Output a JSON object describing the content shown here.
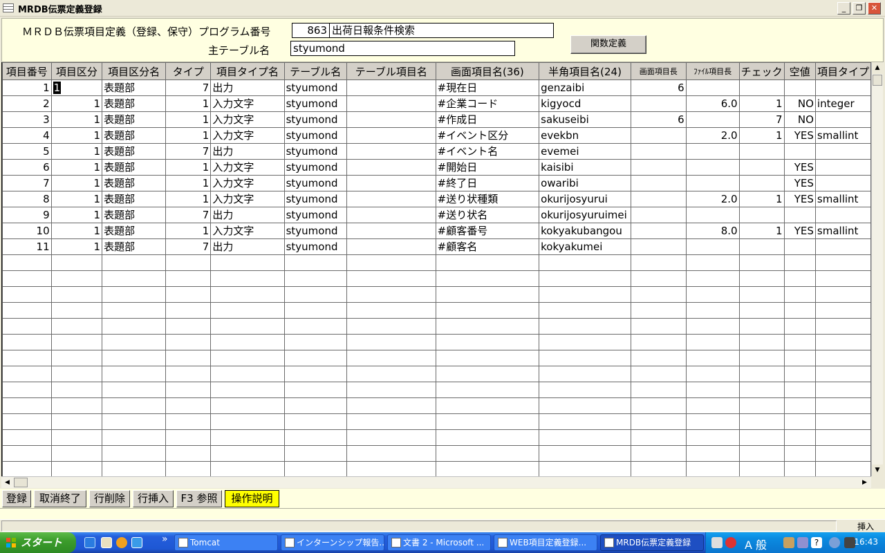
{
  "window": {
    "title": "MRDB伝票定義登録",
    "minimize_glyph": "_",
    "restore_glyph": "❐",
    "close_glyph": "✕"
  },
  "header": {
    "program_label": "ＭＲＤＢ伝票項目定義（登録、保守）プログラム番号",
    "program_number": "863",
    "program_name": "出荷日報条件検索",
    "main_table_label": "主テーブル名",
    "main_table_value": "styumond",
    "function_button": "関数定義"
  },
  "grid": {
    "columns": [
      "項目番号",
      "項目区分",
      "項目区分名",
      "タイプ",
      "項目タイプ名",
      "テーブル名",
      "テーブル項目名",
      "画面項目名(36)",
      "半角項目名(24)",
      "画面項目長",
      "ﾌｧｲﾙ項目長",
      "チェック",
      "空値",
      "項目タイプ"
    ],
    "rows": [
      [
        "1",
        "1",
        "表題部",
        "7",
        "出力",
        "styumond",
        "",
        "#現在日",
        "genzaibi",
        "6",
        "",
        "",
        "",
        ""
      ],
      [
        "2",
        "1",
        "表題部",
        "1",
        "入力文字",
        "styumond",
        "",
        "#企業コード",
        "kigyocd",
        "",
        "6.0",
        "1",
        "NO",
        "integer"
      ],
      [
        "3",
        "1",
        "表題部",
        "1",
        "入力文字",
        "styumond",
        "",
        "#作成日",
        "sakuseibi",
        "6",
        "",
        "7",
        "NO",
        ""
      ],
      [
        "4",
        "1",
        "表題部",
        "1",
        "入力文字",
        "styumond",
        "",
        "#イベント区分",
        "evekbn",
        "",
        "2.0",
        "1",
        "YES",
        "smallint"
      ],
      [
        "5",
        "1",
        "表題部",
        "7",
        "出力",
        "styumond",
        "",
        "#イベント名",
        "evemei",
        "",
        "",
        "",
        "",
        ""
      ],
      [
        "6",
        "1",
        "表題部",
        "1",
        "入力文字",
        "styumond",
        "",
        "#開始日",
        "kaisibi",
        "",
        "",
        "",
        "YES",
        ""
      ],
      [
        "7",
        "1",
        "表題部",
        "1",
        "入力文字",
        "styumond",
        "",
        "#終了日",
        "owaribi",
        "",
        "",
        "",
        "YES",
        ""
      ],
      [
        "8",
        "1",
        "表題部",
        "1",
        "入力文字",
        "styumond",
        "",
        "#送り状種類",
        "okurijosyurui",
        "",
        "2.0",
        "1",
        "YES",
        "smallint"
      ],
      [
        "9",
        "1",
        "表題部",
        "7",
        "出力",
        "styumond",
        "",
        "#送り状名",
        "okurijosyuruimei",
        "",
        "",
        "",
        "",
        ""
      ],
      [
        "10",
        "1",
        "表題部",
        "1",
        "入力文字",
        "styumond",
        "",
        "#顧客番号",
        "kokyakubangou",
        "",
        "8.0",
        "1",
        "YES",
        "smallint"
      ],
      [
        "11",
        "1",
        "表題部",
        "7",
        "出力",
        "styumond",
        "",
        "#顧客名",
        "kokyakumei",
        "",
        "",
        "",
        "",
        ""
      ]
    ],
    "empty_row_count": 14
  },
  "fkeys": [
    {
      "label": "登録",
      "active": false
    },
    {
      "label": "取消終了",
      "active": false
    },
    {
      "label": "行削除",
      "active": false
    },
    {
      "label": "行挿入",
      "active": false
    },
    {
      "label": "F3 参照",
      "active": false
    },
    {
      "label": "操作説明",
      "active": true
    }
  ],
  "statusbar": {
    "mode": "挿入"
  },
  "taskbar": {
    "start_label": "スタート",
    "more_glyph": "»",
    "tasks": [
      {
        "label": "Tomcat",
        "active": false
      },
      {
        "label": "インターンシップ報告...",
        "active": false
      },
      {
        "label": "文書 2 - Microsoft ...",
        "active": false
      },
      {
        "label": "WEB項目定義登録...",
        "active": false
      },
      {
        "label": "MRDB伝票定義登録",
        "active": true
      }
    ],
    "ime_text": "A 般",
    "clock": "16:43"
  },
  "colors": {
    "panel_bg": "#ffffe1",
    "active_fkey": "#ffff00",
    "taskbar": "#245edb",
    "start": "#3c9d2c"
  }
}
